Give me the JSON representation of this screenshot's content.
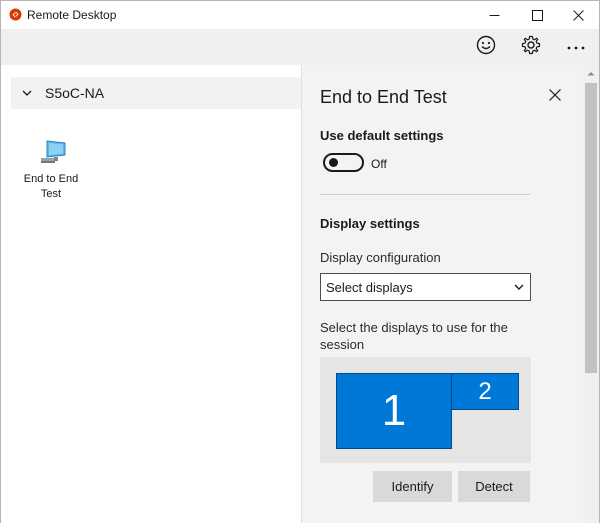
{
  "window": {
    "title": "Remote Desktop",
    "accent_color": "#0078d7"
  },
  "title_bar": {
    "icons": [
      "minimize-icon",
      "maximize-icon",
      "close-icon"
    ]
  },
  "toolbar": {
    "icons": [
      "smiley-icon",
      "gear-icon",
      "more-icon"
    ]
  },
  "left_pane": {
    "group_name": "S5oC-NA",
    "group_expanded": true,
    "tiles": [
      {
        "label": "End to End Test",
        "icon": "pc-monitor-icon"
      }
    ]
  },
  "panel": {
    "title": "End to End Test",
    "use_default_label": "Use default settings",
    "toggle_state": "Off",
    "display_settings_label": "Display settings",
    "display_config_label": "Display configuration",
    "display_config_value": "Select displays",
    "select_displays_label": "Select the displays to use for the session",
    "monitors": [
      {
        "number": "1"
      },
      {
        "number": "2"
      }
    ],
    "identify_label": "Identify",
    "detect_label": "Detect"
  }
}
